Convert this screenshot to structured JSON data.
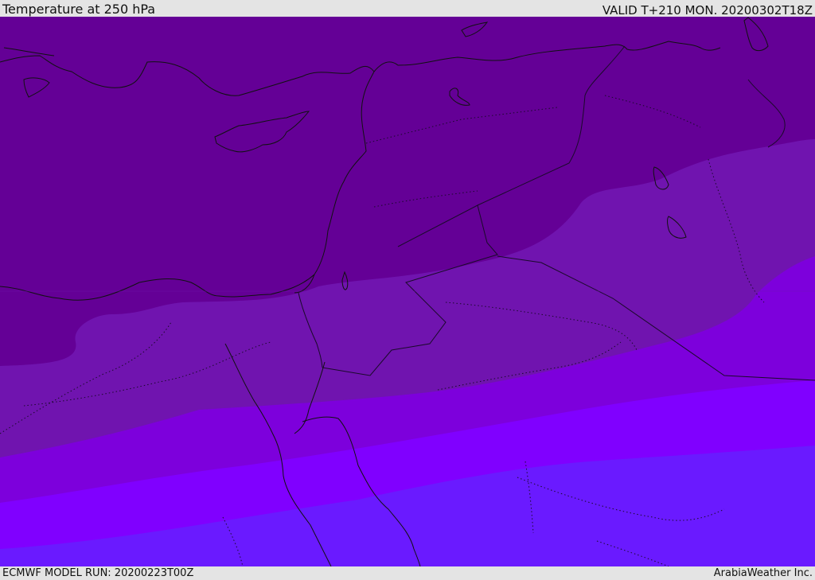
{
  "header": {
    "title": "Temperature at 250 hPa",
    "valid_time": "VALID T+210 MON. 20200302T18Z"
  },
  "footer": {
    "model_run": "ECMWF MODEL RUN: 20200223T00Z",
    "credit": "ArabiaWeather Inc."
  },
  "map": {
    "field": "Temperature at 250 hPa",
    "colors": {
      "band_1": "#640096",
      "band_2": "#7014af",
      "band_3": "#7d00dc",
      "band_4": "#8000ff",
      "band_5": "#6a1aff",
      "coastline": "#111111",
      "border": "#1a0a2a"
    }
  }
}
